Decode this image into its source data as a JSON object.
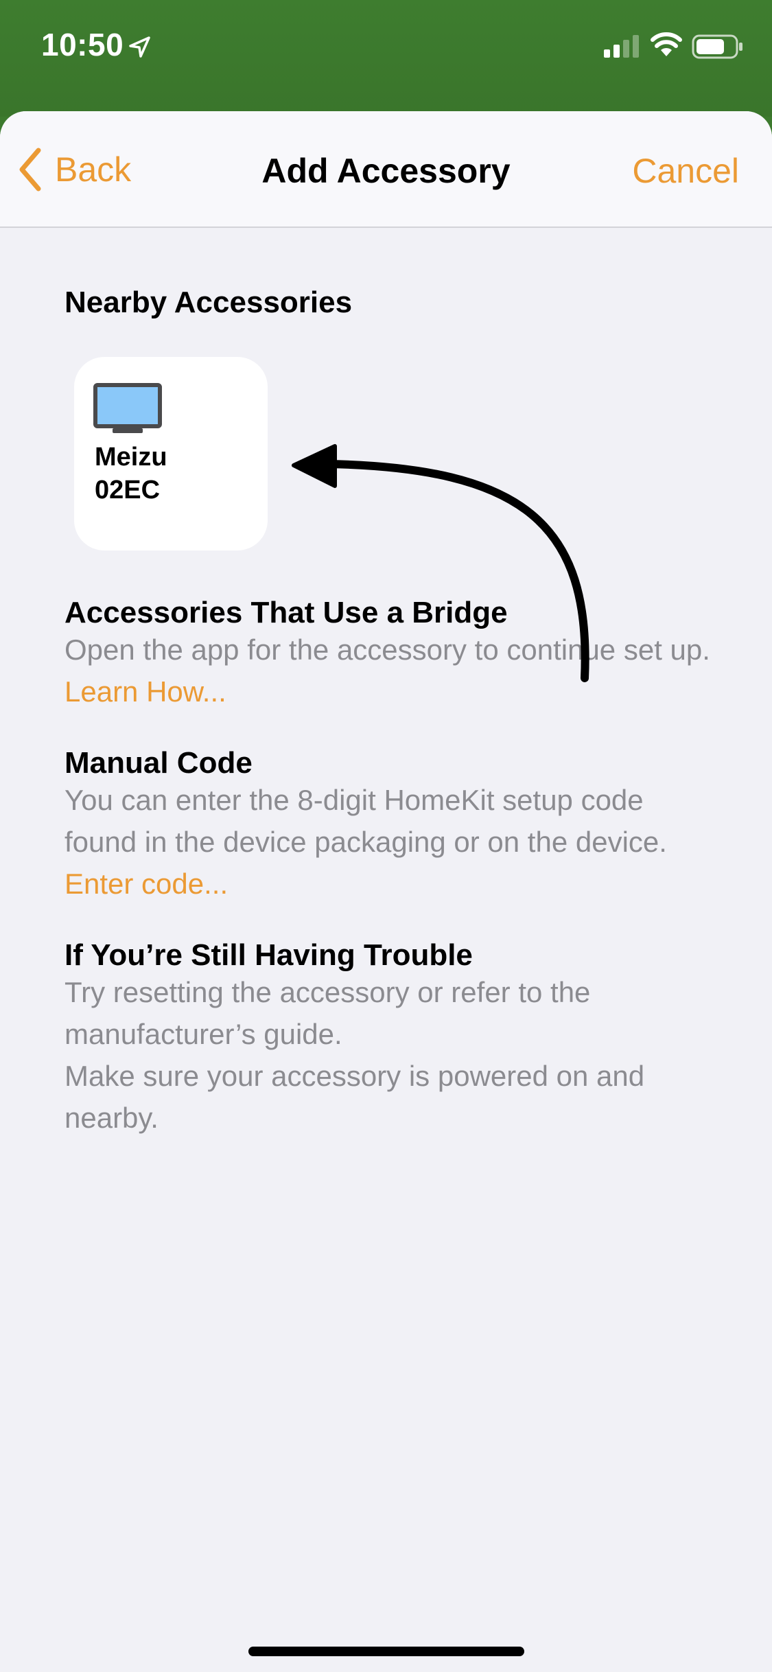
{
  "status_bar": {
    "time": "10:50",
    "icons": [
      "location-arrow-icon",
      "cellular-signal-icon",
      "wifi-icon",
      "battery-icon"
    ]
  },
  "nav": {
    "back_label": "Back",
    "title": "Add Accessory",
    "cancel_label": "Cancel"
  },
  "nearby": {
    "heading": "Nearby Accessories",
    "accessories": [
      {
        "name_line1": "Meizu",
        "name_line2": "02EC",
        "icon": "tv-icon"
      }
    ]
  },
  "bridge": {
    "heading": "Accessories That Use a Bridge",
    "text": "Open the app for the accessory to continue set up.",
    "link": "Learn How..."
  },
  "manual": {
    "heading": "Manual Code",
    "text": "You can enter the 8-digit HomeKit setup code found in the device packaging or on the device.",
    "link": "Enter code..."
  },
  "trouble": {
    "heading": "If You’re Still Having Trouble",
    "line1": "Try resetting the accessory or refer to the manufacturer’s guide.",
    "line2": "Make sure your accessory is powered on and nearby."
  },
  "colors": {
    "accent": "#eb9a34",
    "status_bar_bg": "#3d7a2e",
    "sheet_bg": "#f1f1f6",
    "secondary_text": "#8b8b90",
    "tv_screen": "#8ac8f9"
  }
}
